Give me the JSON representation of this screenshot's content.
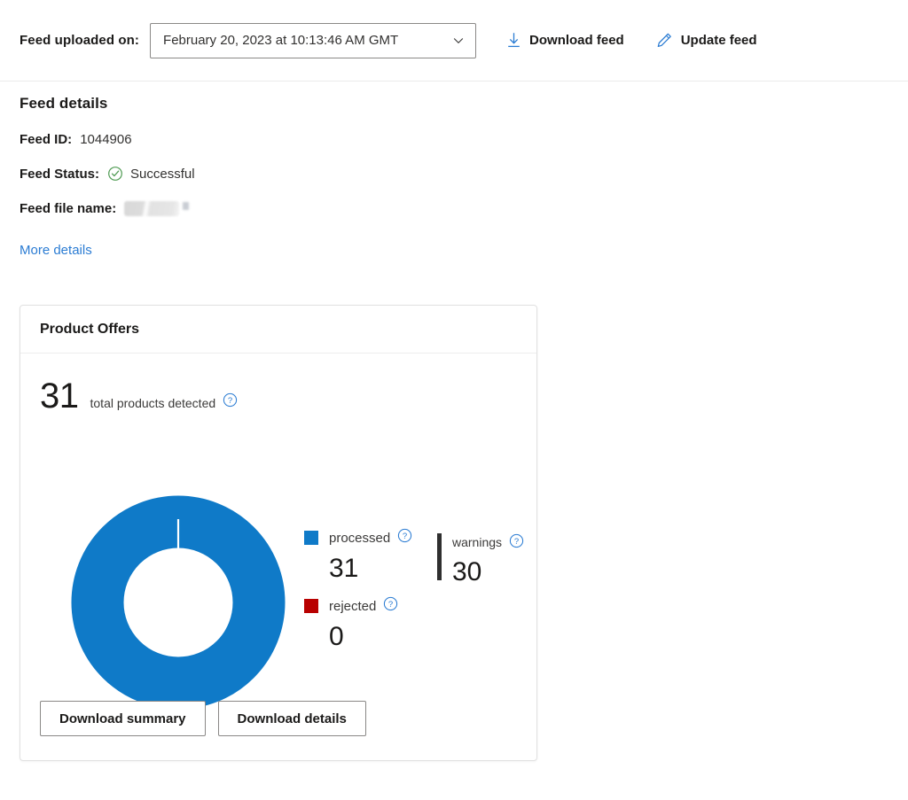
{
  "toolbar": {
    "label": "Feed uploaded on:",
    "selected_date": "February 20, 2023 at 10:13:46 AM GMT",
    "chevron_icon": "chevron-down-icon",
    "download_feed_label": "Download feed",
    "download_feed_icon": "download-arrow-icon",
    "update_feed_label": "Update feed",
    "update_feed_icon": "pencil-edit-icon"
  },
  "details": {
    "heading": "Feed details",
    "feed_id_label": "Feed ID:",
    "feed_id_value": "1044906",
    "feed_status_label": "Feed Status:",
    "feed_status_value": "Successful",
    "feed_status_icon": "check-circle-icon",
    "feed_file_name_label": "Feed file name:",
    "feed_file_name_value": "",
    "more_details_link": "More details"
  },
  "card": {
    "title": "Product Offers",
    "total_value": "31",
    "total_label": "total products detected",
    "help_icon": "help-circle-icon",
    "warnings_label": "warnings",
    "warnings_value": "30",
    "download_summary_label": "Download summary",
    "download_details_label": "Download details"
  },
  "chart_data": {
    "type": "pie",
    "title": "Product Offers",
    "subtitle": "31 total products detected",
    "categories": [
      "processed",
      "rejected"
    ],
    "values": [
      31,
      0
    ],
    "colors": [
      "#0f7ac8",
      "#b80000"
    ],
    "legend": [
      {
        "label": "processed",
        "value": "31",
        "color": "#0f7ac8"
      },
      {
        "label": "rejected",
        "value": "0",
        "color": "#b80000"
      }
    ],
    "annotations": [
      {
        "label": "warnings",
        "value": "30"
      }
    ],
    "total": 31,
    "donut": true,
    "inner_radius_ratio": 0.58,
    "legend_position": "right",
    "grid": false
  },
  "colors": {
    "accent_blue": "#0f7ac8",
    "link_blue": "#2b7cd3",
    "reject_red": "#b80000",
    "success_green": "#4f9b53",
    "text_dark": "#1b1a19"
  }
}
